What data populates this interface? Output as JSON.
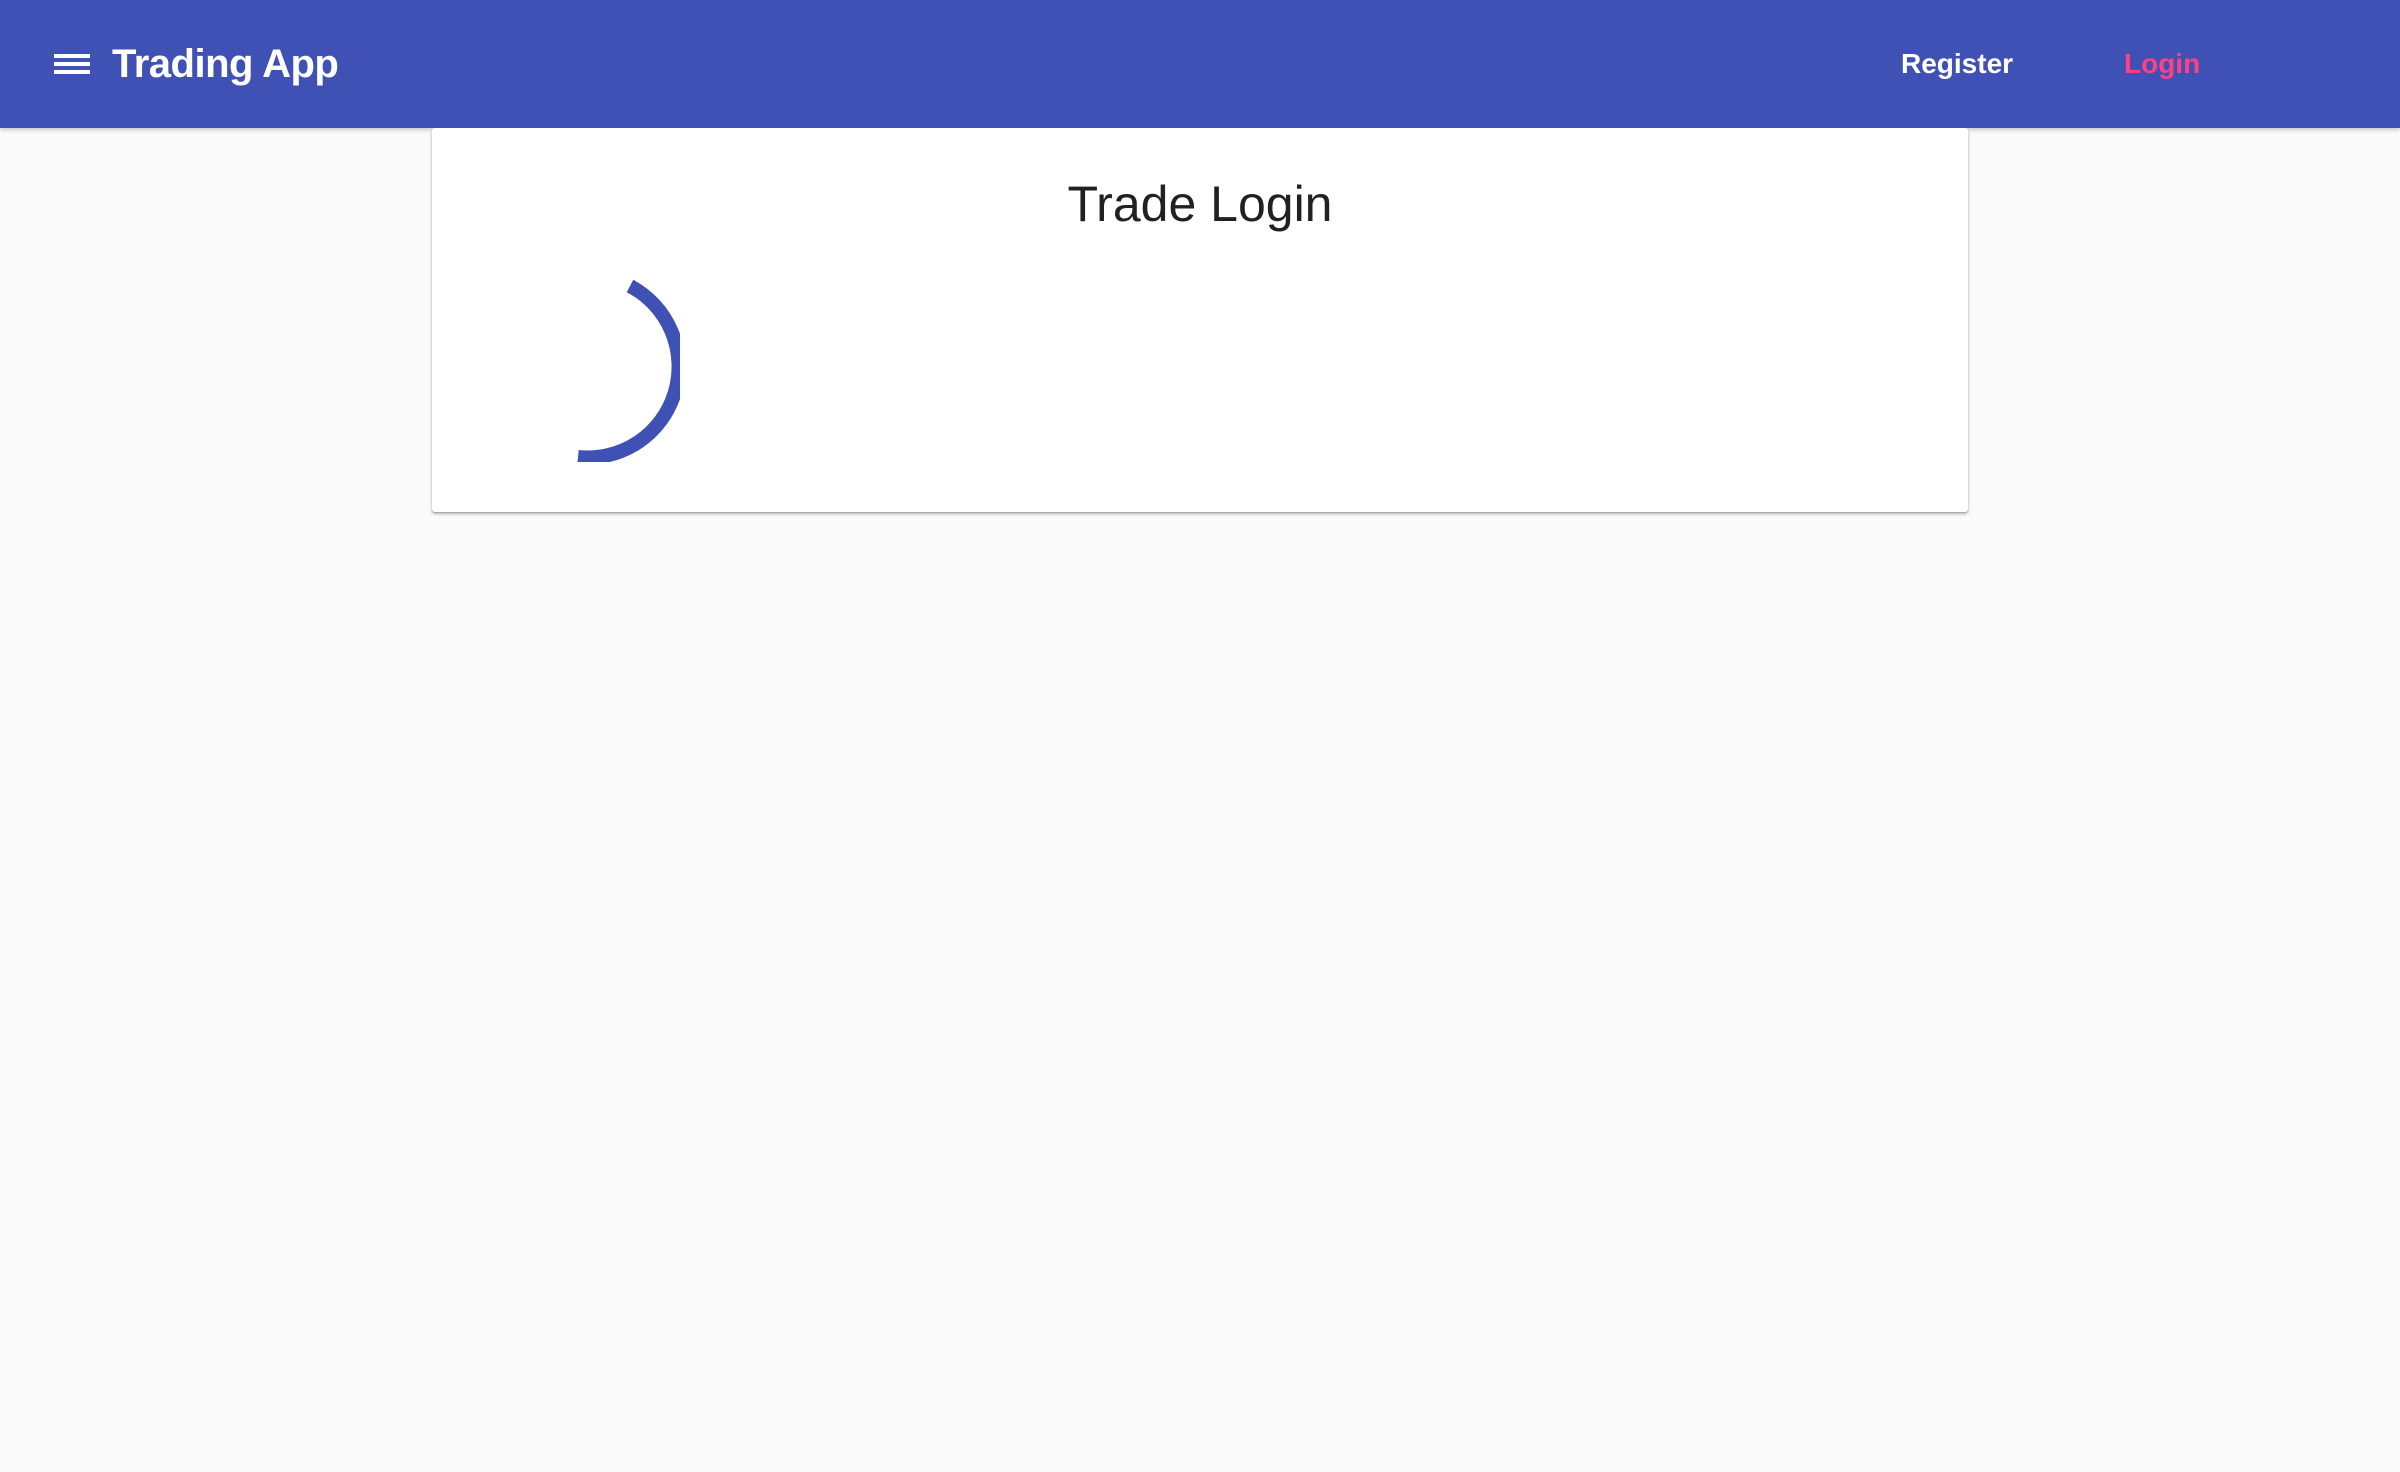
{
  "header": {
    "app_title": "Trading App",
    "menu_icon": "menu-icon",
    "nav": {
      "register_label": "Register",
      "login_label": "Login"
    }
  },
  "main": {
    "card_title": "Trade Login",
    "loading_indicator": "progress-spinner"
  },
  "colors": {
    "primary": "#3f51b5",
    "accent": "#ff4081",
    "background": "#fafafa",
    "card": "#ffffff",
    "text": "#212121"
  }
}
